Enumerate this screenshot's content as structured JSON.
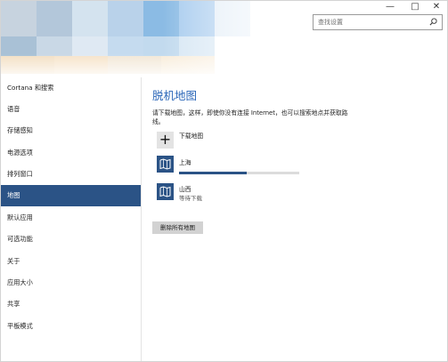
{
  "window": {
    "controls": {
      "minimize_icon": "minimize-icon",
      "maximize_icon": "maximize-icon",
      "close_icon": "close-icon"
    }
  },
  "search": {
    "placeholder": "查找设置",
    "icon": "search-icon"
  },
  "sidebar": {
    "items": [
      {
        "label": "Cortana 和搜索"
      },
      {
        "label": "语音"
      },
      {
        "label": "存储感知"
      },
      {
        "label": "电源选项"
      },
      {
        "label": "排列窗口"
      },
      {
        "label": "地图",
        "selected": true
      },
      {
        "label": "默认应用"
      },
      {
        "label": "可选功能"
      },
      {
        "label": "关于"
      },
      {
        "label": "应用大小"
      },
      {
        "label": "共享"
      },
      {
        "label": "平板模式"
      }
    ]
  },
  "main": {
    "title": "脱机地图",
    "description": "请下载地图，这样，即使你没有连接 Internet，也可以搜索地点并获取路线。",
    "download_label": "下载地图",
    "maps": [
      {
        "name": "上海",
        "status": "",
        "progress": 0.56
      },
      {
        "name": "山西",
        "status": "等待下载"
      }
    ],
    "delete_all_label": "删除所有地图"
  },
  "colors": {
    "accent": "#2b5386",
    "title_blue": "#2a66b8"
  }
}
